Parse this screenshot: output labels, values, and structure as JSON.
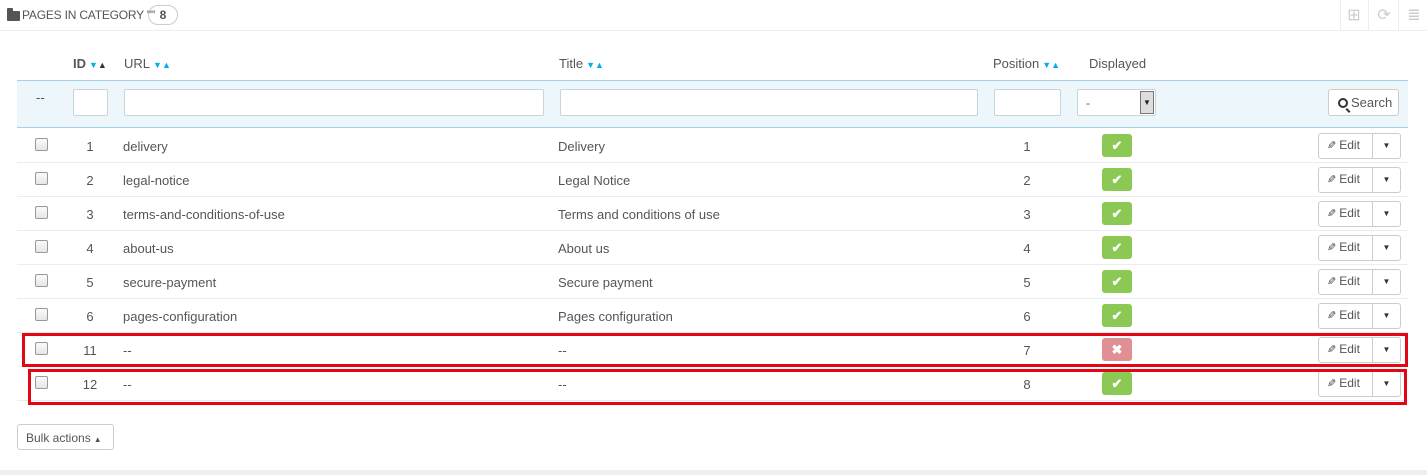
{
  "panel": {
    "title": "PAGES IN CATEGORY \"\"",
    "count": "8",
    "tools": {
      "add_icon": "plus-square-icon",
      "refresh_icon": "refresh-icon",
      "export_icon": "database-icon"
    }
  },
  "columns": {
    "id": "ID",
    "url": "URL",
    "title": "Title",
    "position": "Position",
    "displayed": "Displayed"
  },
  "filters": {
    "dash": "--",
    "displayed_value": "-",
    "search_label": "Search"
  },
  "rows": [
    {
      "id": "1",
      "url": "delivery",
      "title": "Delivery",
      "position": "1",
      "displayed": true
    },
    {
      "id": "2",
      "url": "legal-notice",
      "title": "Legal Notice",
      "position": "2",
      "displayed": true
    },
    {
      "id": "3",
      "url": "terms-and-conditions-of-use",
      "title": "Terms and conditions of use",
      "position": "3",
      "displayed": true
    },
    {
      "id": "4",
      "url": "about-us",
      "title": "About us",
      "position": "4",
      "displayed": true
    },
    {
      "id": "5",
      "url": "secure-payment",
      "title": "Secure payment",
      "position": "5",
      "displayed": true
    },
    {
      "id": "6",
      "url": "pages-configuration",
      "title": "Pages configuration",
      "position": "6",
      "displayed": true
    },
    {
      "id": "11",
      "url": "--",
      "title": "--",
      "position": "7",
      "displayed": false
    },
    {
      "id": "12",
      "url": "--",
      "title": "--",
      "position": "8",
      "displayed": true
    }
  ],
  "row_actions": {
    "edit_label": "Edit"
  },
  "status_symbols": {
    "on": "✔",
    "off": "✖"
  },
  "bulk_actions_label": "Bulk actions",
  "colors": {
    "enabled": "#8bc954",
    "disabled": "#e08f95",
    "highlight": "#e30613",
    "accent": "#00aff0"
  }
}
